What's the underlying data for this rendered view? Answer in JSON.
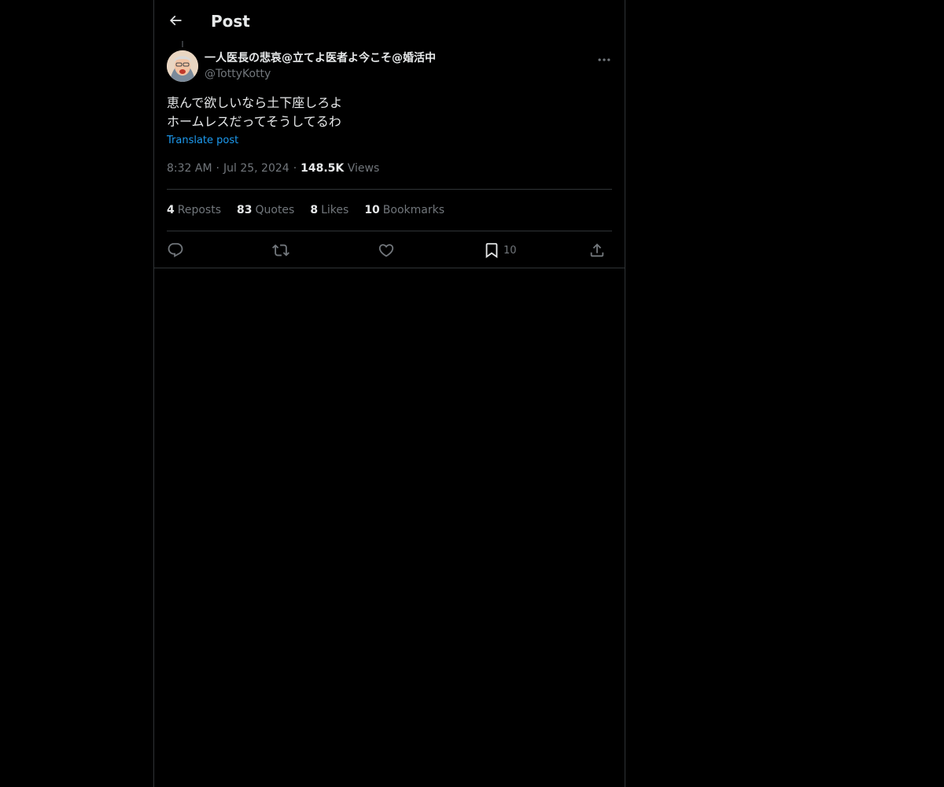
{
  "header": {
    "title": "Post",
    "back_icon": "arrow-left-icon"
  },
  "post": {
    "author": {
      "display_name": "一人医長の悲哀@立てよ医者よ今こそ@婚活中",
      "handle": "@TottyKotty",
      "avatar": "avatar-photo"
    },
    "text_lines": [
      "恵んで欲しいなら土下座しろよ",
      "ホームレスだってそうしてるわ"
    ],
    "translate_label": "Translate post",
    "time": "8:32 AM",
    "date": "Jul 25, 2024",
    "views_count": "148.5K",
    "views_label": "Views",
    "separator": "·"
  },
  "stats": {
    "reposts": {
      "count": "4",
      "label": "Reposts"
    },
    "quotes": {
      "count": "83",
      "label": "Quotes"
    },
    "likes": {
      "count": "8",
      "label": "Likes"
    },
    "bookmarks": {
      "count": "10",
      "label": "Bookmarks"
    }
  },
  "actions": {
    "reply_icon": "reply-icon",
    "repost_icon": "repost-icon",
    "like_icon": "heart-icon",
    "bookmark_icon": "bookmark-icon",
    "bookmark_count": "10",
    "share_icon": "share-icon"
  },
  "colors": {
    "background": "#000000",
    "text": "#e7e9ea",
    "secondary": "#71767b",
    "accent": "#1d9bf0",
    "border": "#2f3336"
  }
}
